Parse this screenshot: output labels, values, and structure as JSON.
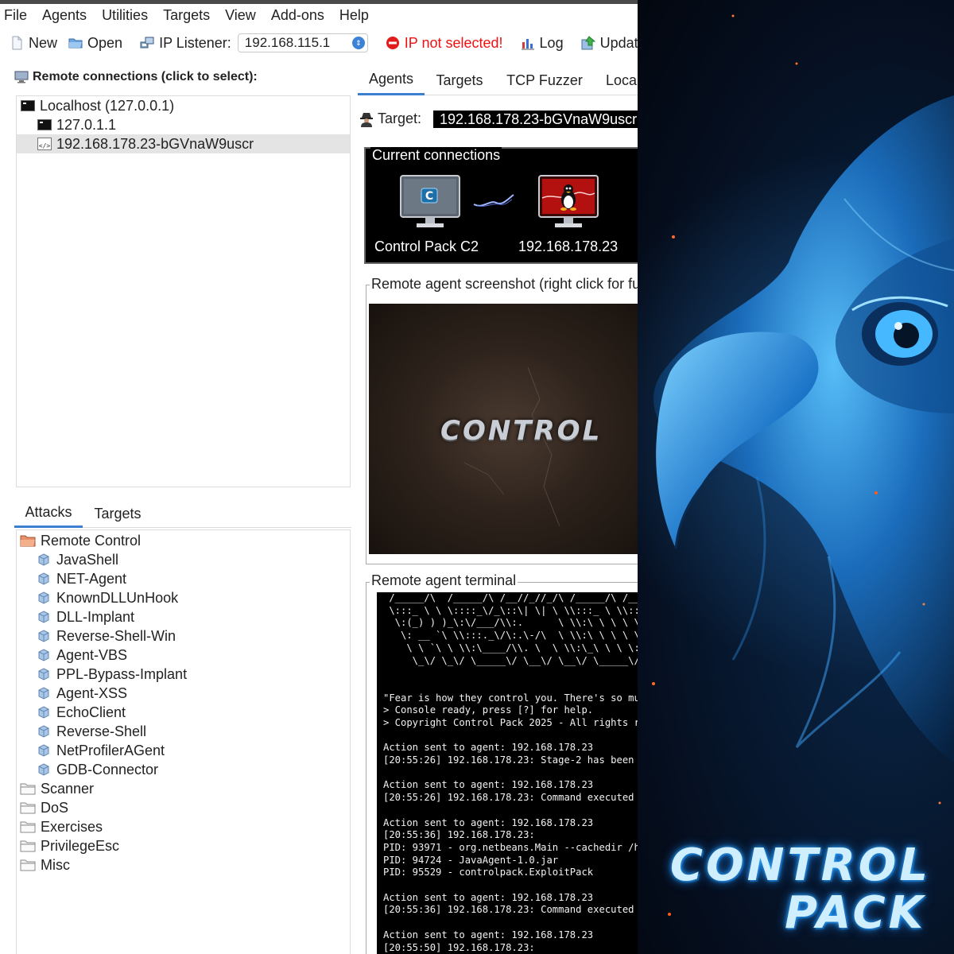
{
  "menu": [
    "File",
    "Agents",
    "Utilities",
    "Targets",
    "View",
    "Add-ons",
    "Help"
  ],
  "toolbar": {
    "new_label": "New",
    "open_label": "Open",
    "ip_listener_label": "IP Listener:",
    "ip_value": "192.168.115.1",
    "ip_error": "IP not selected!",
    "log_label": "Log",
    "update_label": "Update"
  },
  "remote_connections": {
    "title": "Remote connections (click to select):",
    "localhost": "Localhost (127.0.0.1)",
    "items": [
      "127.0.1.1",
      "192.168.178.23-bGVnaW9uscr"
    ]
  },
  "bottom_tabs": [
    "Attacks",
    "Targets"
  ],
  "attacks": {
    "remote_control": "Remote Control",
    "items": [
      "JavaShell",
      "NET-Agent",
      "KnownDLLUnHook",
      "DLL-Implant",
      "Reverse-Shell-Win",
      "Agent-VBS",
      "PPL-Bypass-Implant",
      "Agent-XSS",
      "EchoClient",
      "Reverse-Shell",
      "NetProfilerAGent",
      "GDB-Connector"
    ],
    "folders": [
      "Scanner",
      "DoS",
      "Exercises",
      "PrivilegeEsc",
      "Misc"
    ]
  },
  "main_tabs": [
    "Agents",
    "Targets",
    "TCP Fuzzer",
    "Loca"
  ],
  "target": {
    "label": "Target:",
    "value": "192.168.178.23-bGVnaW9uscr"
  },
  "current_connections": {
    "title": "Current connections",
    "local_label": "Control Pack C2",
    "remote_label": "192.168.178.23"
  },
  "screenshot": {
    "title": "Remote agent screenshot (right click for fu",
    "logo_text": "CONTROL"
  },
  "terminal": {
    "title": "Remote agent terminal",
    "lines": [
      " /_____/\\  /_____/\\ /__//_//_/\\ /_____/\\ /____",
      " \\:::_ \\ \\ \\::::_\\/_\\::\\| \\| \\ \\\\:::_ \\ \\\\:::_",
      "  \\:(_) ) )_\\:\\/___/\\\\:.      \\ \\\\:\\ \\ \\ \\ \\:\\",
      "   \\: __ `\\ \\\\:::._\\/\\:.\\-/\\  \\ \\\\:\\ \\ \\ \\ \\:\\",
      "    \\ \\ `\\ \\ \\\\:\\____/\\\\. \\  \\ \\\\:\\_\\ \\ \\ \\:\\",
      "     \\_\\/ \\_\\/ \\_____\\/ \\__\\/ \\__\\/ \\_____\\/ \\___",
      "",
      "",
      "\"Fear is how they control you. There's so mu",
      "> Console ready, press [?] for help.",
      "> Copyright Control Pack 2025 - All rights r",
      "",
      "Action sent to agent: 192.168.178.23",
      "[20:55:26] 192.168.178.23: Stage-2 has been",
      "",
      "Action sent to agent: 192.168.178.23",
      "[20:55:26] 192.168.178.23: Command executed",
      "",
      "Action sent to agent: 192.168.178.23",
      "[20:55:36] 192.168.178.23:",
      "PID: 93971 - org.netbeans.Main --cachedir /h",
      "PID: 94724 - JavaAgent-1.0.jar",
      "PID: 95529 - controlpack.ExploitPack",
      "",
      "Action sent to agent: 192.168.178.23",
      "[20:55:36] 192.168.178.23: Command executed",
      "",
      "Action sent to agent: 192.168.178.23",
      "[20:55:50] 192.168.178.23:"
    ]
  },
  "artwork": {
    "line1": "CONTROL",
    "line2": "PACK"
  },
  "colors": {
    "accent_tab": "#3c7fd0",
    "error_red": "#e11111",
    "art_glow": "#2ea8ff"
  }
}
